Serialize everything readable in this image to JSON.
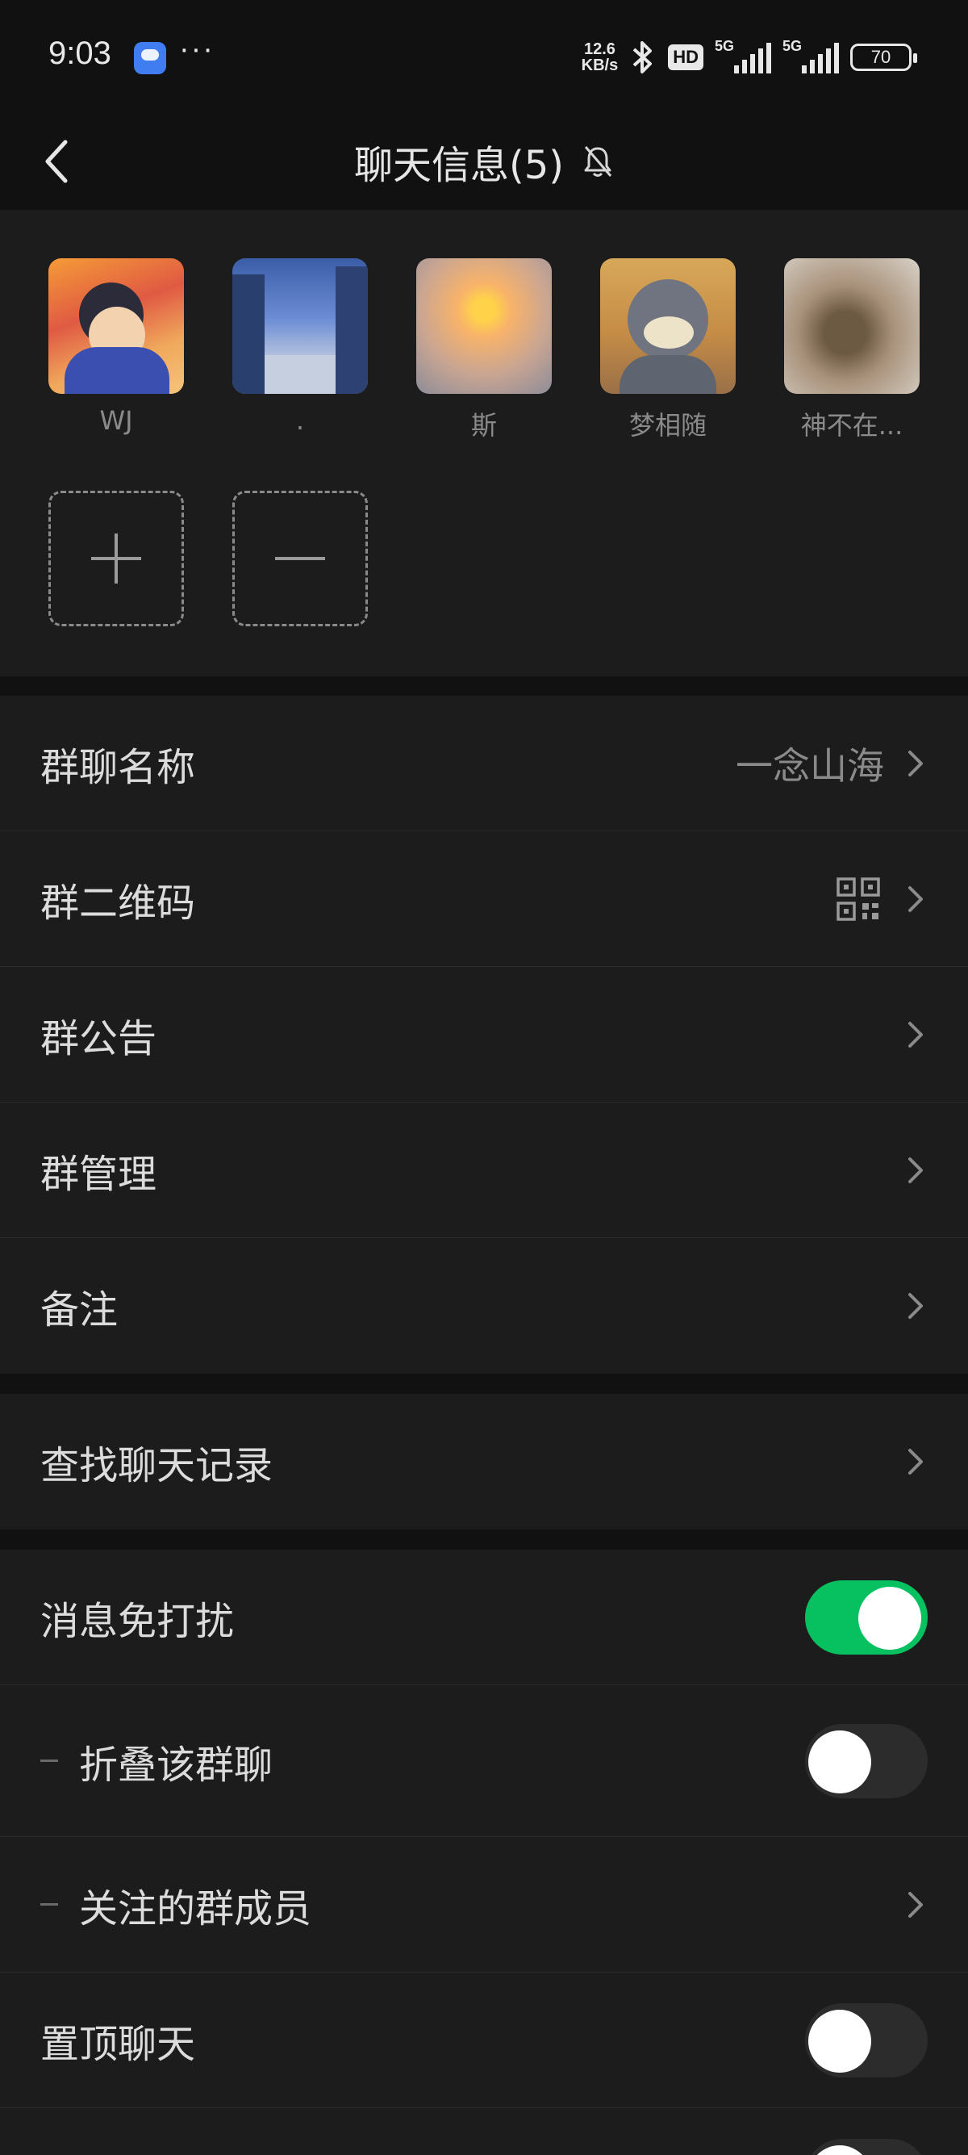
{
  "status_bar": {
    "time": "9:03",
    "more_dots": "···",
    "net_speed_value": "12.6",
    "net_speed_unit": "KB/s",
    "hd_label": "HD",
    "sim1_label": "5G",
    "sim2_label": "5G",
    "battery": "70"
  },
  "nav": {
    "title": "聊天信息(5)",
    "back_icon": "chevron-left-icon",
    "mute_icon": "bell-off-icon"
  },
  "members": [
    {
      "name": "WJ",
      "avatar": "cartoon-boy"
    },
    {
      "name": ".",
      "avatar": "city-street"
    },
    {
      "name": "斯",
      "avatar": "sunset-sea"
    },
    {
      "name": "梦相随",
      "avatar": "cartoon-cat"
    },
    {
      "name": "神不在...",
      "avatar": "dried-flowers"
    }
  ],
  "member_actions": {
    "add_icon": "plus-icon",
    "remove_icon": "minus-icon"
  },
  "group1": {
    "name_label": "群聊名称",
    "name_value": "一念山海",
    "qrcode_label": "群二维码",
    "notice_label": "群公告",
    "manage_label": "群管理",
    "remark_label": "备注"
  },
  "group2": {
    "search_label": "查找聊天记录"
  },
  "group3": {
    "mute_label": "消息免打扰",
    "mute_on": true,
    "fold_label": "折叠该群聊",
    "fold_on": false,
    "follow_label": "关注的群成员",
    "pin_label": "置顶聊天",
    "pin_on": false
  },
  "colors": {
    "background": "#111111",
    "card": "#1c1c1c",
    "toggle_on": "#07c160",
    "toggle_off": "#2c2c2c"
  }
}
